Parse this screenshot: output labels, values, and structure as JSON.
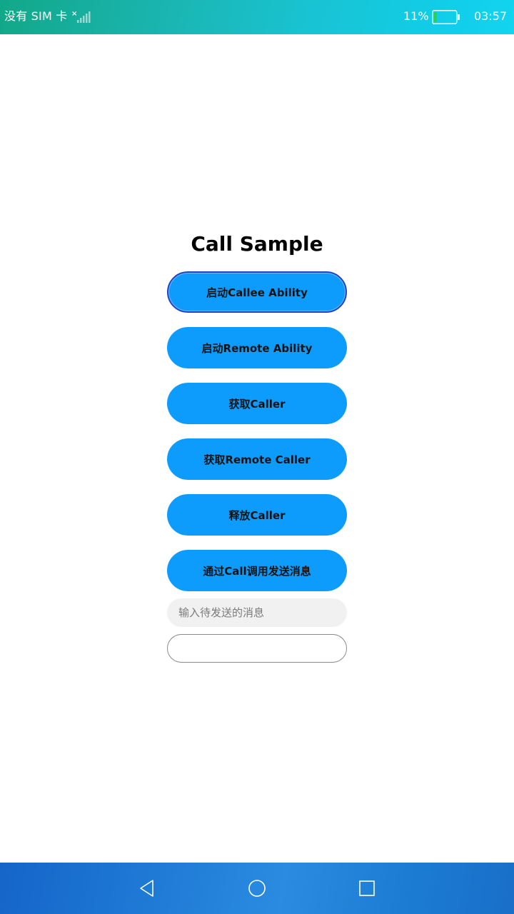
{
  "status_bar": {
    "carrier": "没有 SIM 卡",
    "battery_percent": "11%",
    "battery_level": 0.11,
    "time": "03:57",
    "icons": [
      "no-sim-signal-icon",
      "battery-icon"
    ]
  },
  "main": {
    "title": "Call Sample",
    "buttons": [
      {
        "label": "启动Callee Ability"
      },
      {
        "label": "启动Remote Ability"
      },
      {
        "label": "获取Caller"
      },
      {
        "label": "获取Remote Caller"
      },
      {
        "label": "释放Caller"
      },
      {
        "label": "通过Call调用发送消息"
      }
    ],
    "message_input": {
      "value": "",
      "placeholder": "输入待发送的消息"
    },
    "result": {
      "value": ""
    }
  },
  "nav_bar": {
    "icons": [
      "back-icon",
      "home-icon",
      "recents-icon"
    ]
  },
  "colors": {
    "button": "#0d9cfb",
    "focus_border": "#1a45c8",
    "input_bg": "#f1f1f1",
    "battery_fill": "#2ad24a"
  }
}
